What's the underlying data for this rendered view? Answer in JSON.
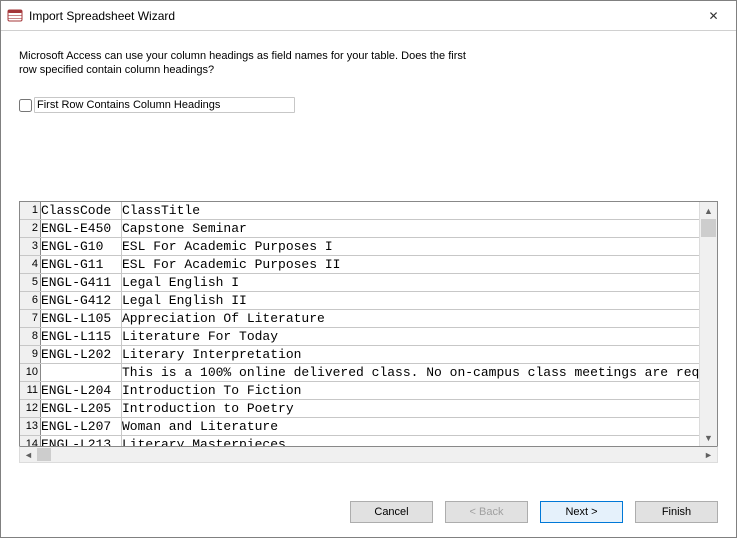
{
  "window": {
    "title": "Import Spreadsheet Wizard",
    "close_glyph": "✕"
  },
  "intro": {
    "line1": "Microsoft Access can use your column headings as field names for your table. Does the first",
    "line2": "row specified contain column headings?"
  },
  "checkbox": {
    "label": "First Row Contains Column Headings",
    "checked": false
  },
  "grid": {
    "rows": [
      {
        "n": "1",
        "c1": "ClassCode",
        "c2": "ClassTitle"
      },
      {
        "n": "2",
        "c1": "ENGL-E450",
        "c2": "Capstone Seminar"
      },
      {
        "n": "3",
        "c1": "ENGL-G10",
        "c2": "ESL For Academic Purposes I"
      },
      {
        "n": "4",
        "c1": "ENGL-G11",
        "c2": "ESL For Academic Purposes II"
      },
      {
        "n": "5",
        "c1": "ENGL-G411",
        "c2": "Legal English I"
      },
      {
        "n": "6",
        "c1": "ENGL-G412",
        "c2": "Legal English II"
      },
      {
        "n": "7",
        "c1": "ENGL-L105",
        "c2": "Appreciation Of Literature"
      },
      {
        "n": "8",
        "c1": "ENGL-L115",
        "c2": "Literature For Today"
      },
      {
        "n": "9",
        "c1": "ENGL-L202",
        "c2": "Literary Interpretation"
      },
      {
        "n": "10",
        "c1": "",
        "c2": "This is a 100% online delivered class. No on-campus class meetings are requ"
      },
      {
        "n": "11",
        "c1": "ENGL-L204",
        "c2": "Introduction To Fiction"
      },
      {
        "n": "12",
        "c1": "ENGL-L205",
        "c2": "Introduction to Poetry"
      },
      {
        "n": "13",
        "c1": "ENGL-L207",
        "c2": "Woman and Literature"
      },
      {
        "n": "14",
        "c1": "ENGL-L213",
        "c2": "Literary Masterpieces"
      }
    ]
  },
  "buttons": {
    "cancel": "Cancel",
    "back": "< Back",
    "next": "Next >",
    "finish": "Finish"
  }
}
